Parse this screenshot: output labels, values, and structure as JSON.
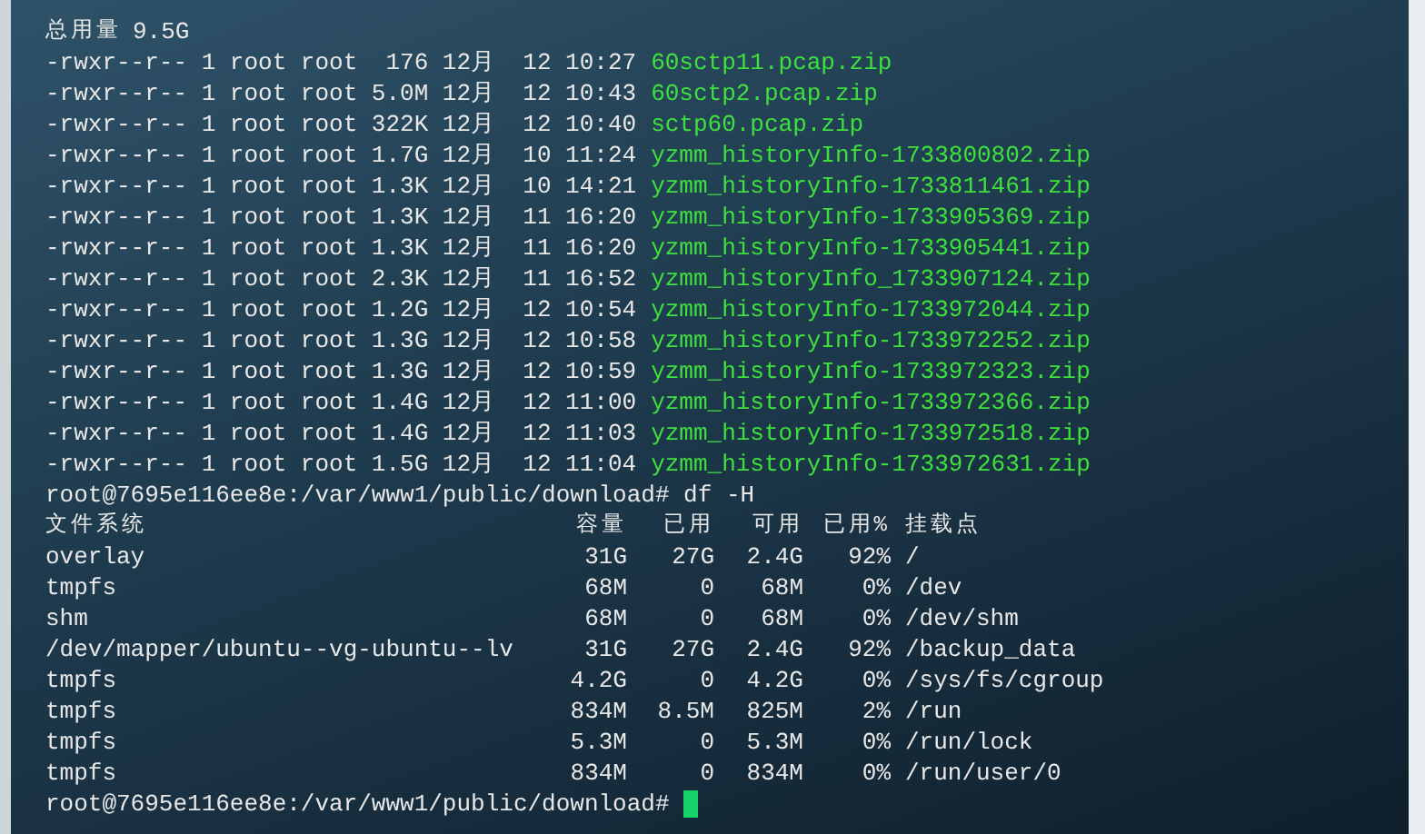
{
  "total": {
    "label": "总用量",
    "value": "9.5G"
  },
  "files": [
    {
      "meta": "-rwxr--r-- 1 root root  176 12月  12 10:27",
      "name": "60sctp11.pcap.zip"
    },
    {
      "meta": "-rwxr--r-- 1 root root 5.0M 12月  12 10:43",
      "name": "60sctp2.pcap.zip"
    },
    {
      "meta": "-rwxr--r-- 1 root root 322K 12月  12 10:40",
      "name": "sctp60.pcap.zip"
    },
    {
      "meta": "-rwxr--r-- 1 root root 1.7G 12月  10 11:24",
      "name": "yzmm_historyInfo-1733800802.zip"
    },
    {
      "meta": "-rwxr--r-- 1 root root 1.3K 12月  10 14:21",
      "name": "yzmm_historyInfo-1733811461.zip"
    },
    {
      "meta": "-rwxr--r-- 1 root root 1.3K 12月  11 16:20",
      "name": "yzmm_historyInfo-1733905369.zip"
    },
    {
      "meta": "-rwxr--r-- 1 root root 1.3K 12月  11 16:20",
      "name": "yzmm_historyInfo-1733905441.zip"
    },
    {
      "meta": "-rwxr--r-- 1 root root 2.3K 12月  11 16:52",
      "name": "yzmm_historyInfo_1733907124.zip"
    },
    {
      "meta": "-rwxr--r-- 1 root root 1.2G 12月  12 10:54",
      "name": "yzmm_historyInfo-1733972044.zip"
    },
    {
      "meta": "-rwxr--r-- 1 root root 1.3G 12月  12 10:58",
      "name": "yzmm_historyInfo-1733972252.zip"
    },
    {
      "meta": "-rwxr--r-- 1 root root 1.3G 12月  12 10:59",
      "name": "yzmm_historyInfo-1733972323.zip"
    },
    {
      "meta": "-rwxr--r-- 1 root root 1.4G 12月  12 11:00",
      "name": "yzmm_historyInfo-1733972366.zip"
    },
    {
      "meta": "-rwxr--r-- 1 root root 1.4G 12月  12 11:03",
      "name": "yzmm_historyInfo-1733972518.zip"
    },
    {
      "meta": "-rwxr--r-- 1 root root 1.5G 12月  12 11:04",
      "name": "yzmm_historyInfo-1733972631.zip"
    }
  ],
  "df_command": "root@7695e116ee8e:/var/www1/public/download# df -H",
  "df_columns": [
    "文件系统",
    "容量",
    "已用",
    "可用",
    "已用%",
    "挂载点"
  ],
  "df_rows": [
    [
      "overlay",
      "31G",
      "27G",
      "2.4G",
      "92%",
      "/"
    ],
    [
      "tmpfs",
      "68M",
      "0",
      "68M",
      "0%",
      "/dev"
    ],
    [
      "shm",
      "68M",
      "0",
      "68M",
      "0%",
      "/dev/shm"
    ],
    [
      "/dev/mapper/ubuntu--vg-ubuntu--lv",
      "31G",
      "27G",
      "2.4G",
      "92%",
      "/backup_data"
    ],
    [
      "tmpfs",
      "4.2G",
      "0",
      "4.2G",
      "0%",
      "/sys/fs/cgroup"
    ],
    [
      "tmpfs",
      "834M",
      "8.5M",
      "825M",
      "2%",
      "/run"
    ],
    [
      "tmpfs",
      "5.3M",
      "0",
      "5.3M",
      "0%",
      "/run/lock"
    ],
    [
      "tmpfs",
      "834M",
      "0",
      "834M",
      "0%",
      "/run/user/0"
    ]
  ],
  "prompt": "root@7695e116ee8e:/var/www1/public/download#"
}
